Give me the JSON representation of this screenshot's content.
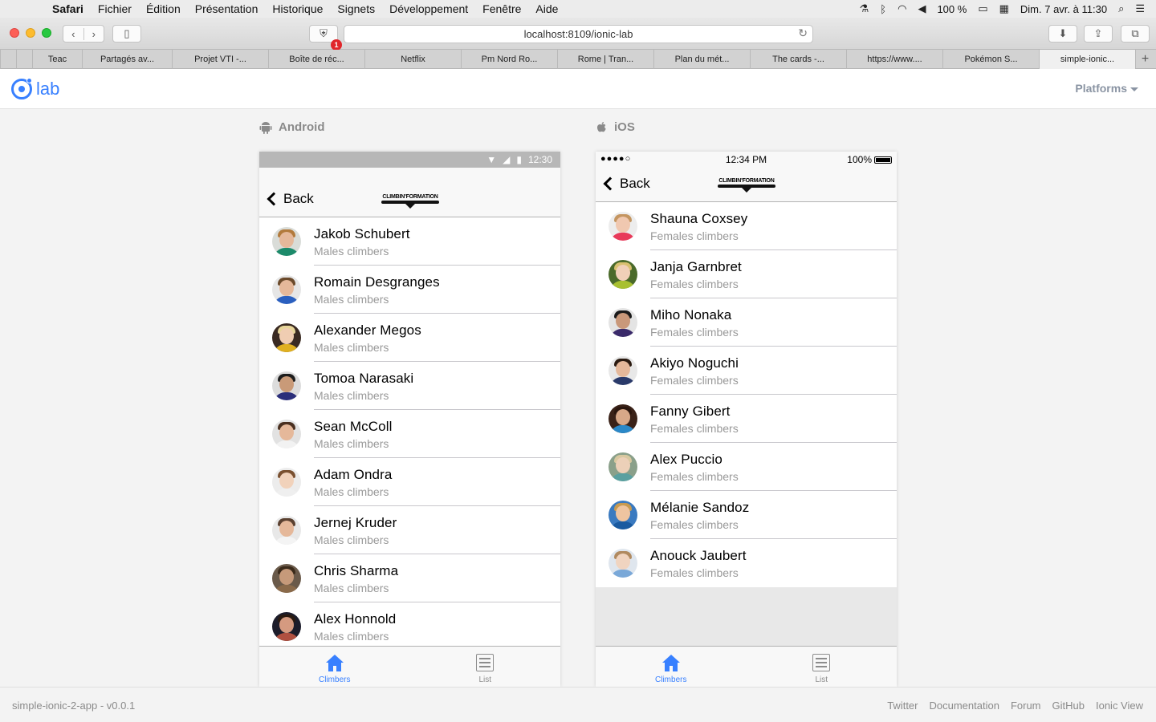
{
  "menubar": {
    "app": "Safari",
    "items": [
      "Fichier",
      "Édition",
      "Présentation",
      "Historique",
      "Signets",
      "Développement",
      "Fenêtre",
      "Aide"
    ],
    "battery": "100 %",
    "datetime": "Dim. 7 avr. à  11:30"
  },
  "toolbar": {
    "url": "localhost:8109/ionic-lab",
    "badge": "1"
  },
  "tabs": [
    {
      "label": "Teac"
    },
    {
      "label": "Partagés av..."
    },
    {
      "label": "Projet VTI -..."
    },
    {
      "label": "Boîte de réc..."
    },
    {
      "label": "Netflix"
    },
    {
      "label": "Pm Nord Ro..."
    },
    {
      "label": "Rome | Tran..."
    },
    {
      "label": "Plan du mét..."
    },
    {
      "label": "The cards -..."
    },
    {
      "label": "https://www...."
    },
    {
      "label": "Pokémon S..."
    },
    {
      "label": "simple-ionic..."
    }
  ],
  "lab": {
    "logo_text": "lab",
    "platforms_label": "Platforms"
  },
  "android": {
    "label": "Android",
    "time": "12:30",
    "back": "Back",
    "logo_text": "CLIMBIN'FORMATION",
    "items": [
      {
        "name": "Jakob Schubert",
        "category": "Males climbers"
      },
      {
        "name": "Romain Desgranges",
        "category": "Males climbers"
      },
      {
        "name": "Alexander Megos",
        "category": "Males climbers"
      },
      {
        "name": "Tomoa Narasaki",
        "category": "Males climbers"
      },
      {
        "name": "Sean McColl",
        "category": "Males climbers"
      },
      {
        "name": "Adam Ondra",
        "category": "Males climbers"
      },
      {
        "name": "Jernej Kruder",
        "category": "Males climbers"
      },
      {
        "name": "Chris Sharma",
        "category": "Males climbers"
      },
      {
        "name": "Alex Honnold",
        "category": "Males climbers"
      }
    ],
    "tab_climbers": "Climbers",
    "tab_list": "List"
  },
  "ios": {
    "label": "iOS",
    "signal": "●●●●○",
    "time": "12:34 PM",
    "battery": "100%",
    "back": "Back",
    "logo_text": "CLIMBIN'FORMATION",
    "items": [
      {
        "name": "Shauna Coxsey",
        "category": "Females climbers"
      },
      {
        "name": "Janja Garnbret",
        "category": "Females climbers"
      },
      {
        "name": "Miho Nonaka",
        "category": "Females climbers"
      },
      {
        "name": "Akiyo Noguchi",
        "category": "Females climbers"
      },
      {
        "name": "Fanny Gibert",
        "category": "Females climbers"
      },
      {
        "name": "Alex Puccio",
        "category": "Females climbers"
      },
      {
        "name": "Mélanie Sandoz",
        "category": "Females climbers"
      },
      {
        "name": "Anouck Jaubert",
        "category": "Females climbers"
      }
    ],
    "tab_climbers": "Climbers",
    "tab_list": "List"
  },
  "footer": {
    "version": "simple-ionic-2-app - v0.0.1",
    "links": [
      "Twitter",
      "Documentation",
      "Forum",
      "GitHub",
      "Ionic View"
    ]
  },
  "colors": {
    "accent": "#3880ff",
    "muted": "#999999"
  }
}
